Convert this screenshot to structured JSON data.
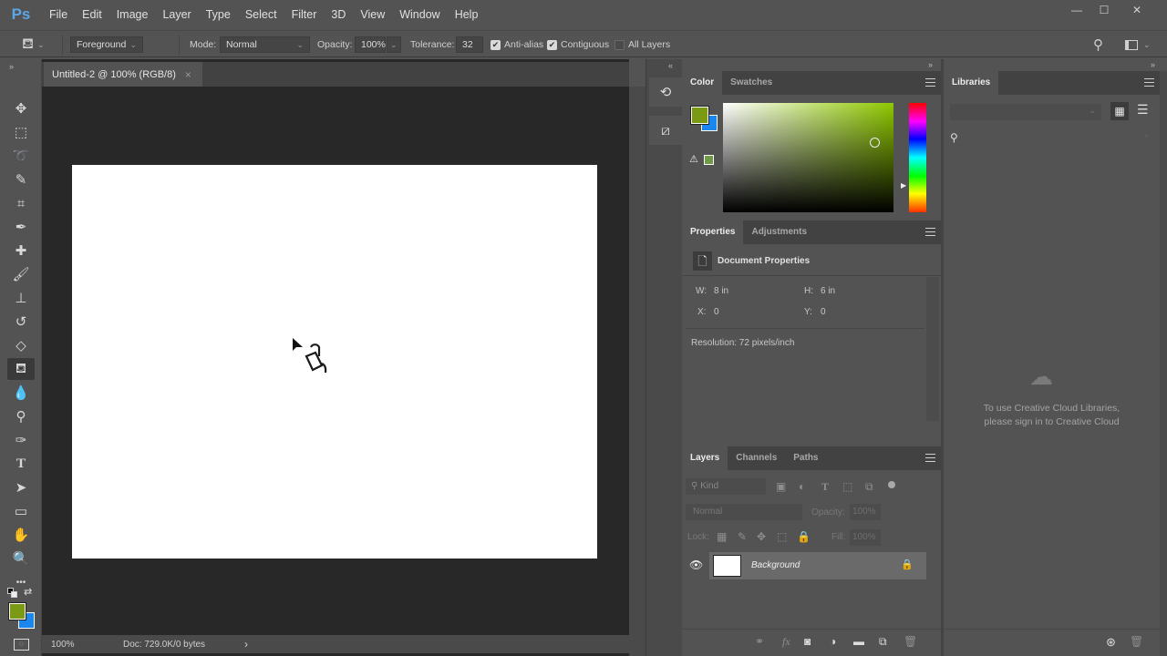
{
  "app": {
    "logo": "Ps",
    "menu": [
      "File",
      "Edit",
      "Image",
      "Layer",
      "Type",
      "Select",
      "Filter",
      "3D",
      "View",
      "Window",
      "Help"
    ],
    "window_controls": {
      "minimize": "—",
      "maximize": "☐",
      "close": "✕"
    }
  },
  "options_bar": {
    "tool_icon": "paint-bucket-icon",
    "fill_source": "Foreground",
    "mode_label": "Mode:",
    "mode_value": "Normal",
    "opacity_label": "Opacity:",
    "opacity_value": "100%",
    "tolerance_label": "Tolerance:",
    "tolerance_value": "32",
    "anti_alias": {
      "label": "Anti-alias",
      "checked": true
    },
    "contiguous": {
      "label": "Contiguous",
      "checked": true
    },
    "all_layers": {
      "label": "All Layers",
      "checked": false
    }
  },
  "toolbox": {
    "tools": [
      {
        "name": "move-tool",
        "glyph": "✥"
      },
      {
        "name": "marquee-tool",
        "glyph": "⬚"
      },
      {
        "name": "lasso-tool",
        "glyph": "➰"
      },
      {
        "name": "quick-selection-tool",
        "glyph": "✎"
      },
      {
        "name": "crop-tool",
        "glyph": "⌗"
      },
      {
        "name": "eyedropper-tool",
        "glyph": "✒"
      },
      {
        "name": "healing-brush-tool",
        "glyph": "✚"
      },
      {
        "name": "brush-tool",
        "glyph": "🖌"
      },
      {
        "name": "clone-stamp-tool",
        "glyph": "⊥"
      },
      {
        "name": "history-brush-tool",
        "glyph": "↺"
      },
      {
        "name": "eraser-tool",
        "glyph": "◇"
      },
      {
        "name": "paint-bucket-tool",
        "glyph": "⛾",
        "active": true
      },
      {
        "name": "blur-tool",
        "glyph": "💧"
      },
      {
        "name": "dodge-tool",
        "glyph": "⚲"
      },
      {
        "name": "pen-tool",
        "glyph": "✑"
      },
      {
        "name": "type-tool",
        "glyph": "T"
      },
      {
        "name": "path-selection-tool",
        "glyph": "➤"
      },
      {
        "name": "rectangle-tool",
        "glyph": "▭"
      },
      {
        "name": "hand-tool",
        "glyph": "✋"
      },
      {
        "name": "zoom-tool",
        "glyph": "🔍"
      },
      {
        "name": "edit-toolbar",
        "glyph": "•••"
      }
    ],
    "foreground_color": "#7a9a14",
    "background_color": "#1a86f0"
  },
  "document": {
    "tab_title": "Untitled-2 @ 100% (RGB/8)",
    "tab_close": "×",
    "zoom": "100%",
    "doc_info": "Doc: 729.0K/0 bytes",
    "status_arrow": "›"
  },
  "color_panel": {
    "tabs": [
      "Color",
      "Swatches"
    ],
    "foreground": "#7a9a14",
    "background": "#1a86f0",
    "gamut_swatch": "#6f9a46",
    "hue_color": "#8fc800"
  },
  "properties_panel": {
    "tabs": [
      "Properties",
      "Adjustments"
    ],
    "title": "Document Properties",
    "w_label": "W:",
    "w_value": "8 in",
    "h_label": "H:",
    "h_value": "6 in",
    "x_label": "X:",
    "x_value": "0",
    "y_label": "Y:",
    "y_value": "0",
    "resolution": "Resolution: 72 pixels/inch"
  },
  "layers_panel": {
    "tabs": [
      "Layers",
      "Channels",
      "Paths"
    ],
    "filter_placeholder": "Kind",
    "blend_mode": "Normal",
    "opacity_label": "Opacity:",
    "opacity_value": "100%",
    "lock_label": "Lock:",
    "fill_label": "Fill:",
    "fill_value": "100%",
    "layers": [
      {
        "name": "Background",
        "visible": true,
        "locked": true
      }
    ]
  },
  "libraries_panel": {
    "tab": "Libraries",
    "message_line1": "To use Creative Cloud Libraries,",
    "message_line2": "please sign in to Creative Cloud"
  }
}
